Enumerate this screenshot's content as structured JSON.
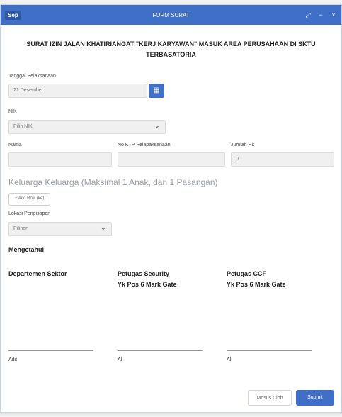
{
  "titlebar": {
    "logo": "Sep",
    "title": "FORM SURAT",
    "controls": [
      "⤢",
      "−",
      "×"
    ]
  },
  "heading": "SURAT IZIN JALAN KHATIRIANGAT \"KERJ KARYAWAN\" MASUK AREA PERUSAHAAN DI SKTU TERBASATORIA",
  "form": {
    "tanggal_label": "Tanggal Pelaksanaan",
    "tanggal_placeholder": "21 Desember",
    "calendar_icon": "calendar-icon",
    "nik_label": "NIK",
    "nik_value": "Pilih NIK",
    "nama_label": "Nama",
    "nama_value": "",
    "no_ktp_label": "No KTP Pelapaksanaan",
    "no_ktp_value": "",
    "jumlah_label": "Jumlah Hk",
    "jumlah_value": "0"
  },
  "keluarga": {
    "title": "Keluarga Keluarga (Maksimal 1 Anak, dan 1 Pasangan)",
    "add_label": "+ Add Row (ke)",
    "status_label": "Lokasi Pengisapan",
    "status_value": "Pilihan"
  },
  "mengetahui": {
    "title": "Mengetahui",
    "columns": [
      {
        "line1": "Departemen Sektor",
        "line2": "",
        "name": "Adit"
      },
      {
        "line1": "Petugas Security",
        "line2": "Yk Pos 6 Mark Gate",
        "name": "Al"
      },
      {
        "line1": "Petugas CCF",
        "line2": "Yk Pos 6 Mark Gate",
        "name": "Al"
      }
    ]
  },
  "buttons": {
    "secondary": "Mosus Clob",
    "primary": "Submit"
  },
  "colors": {
    "accent": "#3f6fc6"
  }
}
